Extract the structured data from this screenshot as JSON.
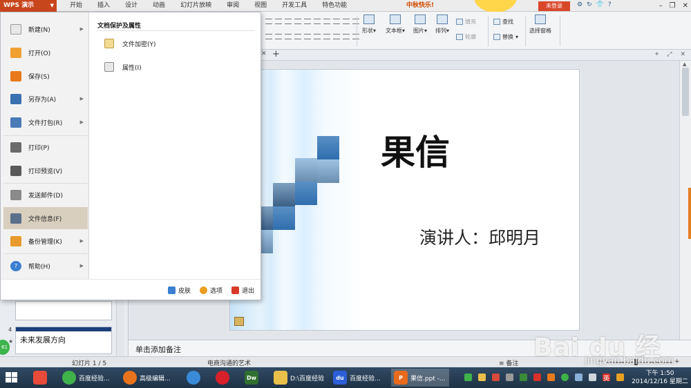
{
  "titlebar": {
    "app_name": "WPS 演示",
    "menu_tabs": [
      "开始",
      "插入",
      "设计",
      "动画",
      "幻灯片放映",
      "审阅",
      "视图",
      "开发工具",
      "特色功能"
    ],
    "festival_text": "中秋快乐!",
    "login_label": "未登录",
    "icons": [
      "settings-icon",
      "refresh-icon",
      "skin-icon",
      "help-icon"
    ],
    "window_controls": [
      "minimize-icon",
      "restore-icon",
      "close-icon"
    ]
  },
  "toolbar": {
    "shape_label": "形状",
    "textbox_label": "文本框",
    "picture_label": "图片",
    "fill_label": "填充",
    "arrange_label": "排列",
    "outline_label": "轮廓",
    "find_label": "查找",
    "replace_label": "替换",
    "select_pane_label": "选择窗格"
  },
  "file_menu": {
    "items": [
      {
        "label": "新建(N)",
        "icon": "new-document-icon",
        "color": "#e8e8e8",
        "has_arrow": true
      },
      {
        "label": "打开(O)",
        "icon": "open-folder-icon",
        "color": "#f0a030",
        "has_arrow": false
      },
      {
        "label": "保存(S)",
        "icon": "save-icon",
        "color": "#e87a1c",
        "has_arrow": false
      },
      {
        "label": "另存为(A)",
        "icon": "save-as-icon",
        "color": "#3a6fb0",
        "has_arrow": true
      },
      {
        "label": "文件打包(R)",
        "icon": "package-icon",
        "color": "#4a7ab8",
        "has_arrow": true
      },
      {
        "label": "打印(P)",
        "icon": "print-icon",
        "color": "#6a6a6a",
        "has_arrow": false
      },
      {
        "label": "打印预览(V)",
        "icon": "print-preview-icon",
        "color": "#5a5a5a",
        "has_arrow": false
      },
      {
        "label": "发送邮件(D)",
        "icon": "mail-icon",
        "color": "#8a8a8a",
        "has_arrow": false
      },
      {
        "label": "文件信息(F)",
        "icon": "file-info-icon",
        "color": "#5a6f8a",
        "has_arrow": false
      },
      {
        "label": "备份管理(K)",
        "icon": "backup-icon",
        "color": "#e89a2c",
        "has_arrow": true
      },
      {
        "label": "帮助(H)",
        "icon": "help-circle-icon",
        "color": "#3a7fd0",
        "has_arrow": true
      }
    ],
    "submenu_header": "文档保护及属性",
    "submenu_items": [
      {
        "label": "文件加密(Y)",
        "icon": "lock-icon"
      },
      {
        "label": "属性(I)",
        "icon": "properties-icon"
      }
    ],
    "footer": {
      "skin_label": "皮肤",
      "options_label": "选项",
      "exit_label": "退出"
    }
  },
  "slide": {
    "title": "果信",
    "subtitle": "演讲人：邱明月"
  },
  "slide_panel": {
    "slide4_number": "4",
    "slide4_star": "★",
    "slide4_label": "未来发展方向",
    "badge": "61"
  },
  "notes": {
    "placeholder": "单击添加备注"
  },
  "statusbar": {
    "slide_counter": "幻灯片 1 / 5",
    "theme_name": "电商沟通的艺术",
    "notes_label": "备注",
    "zoom_minus": "−",
    "zoom_plus": "+"
  },
  "taskbar": {
    "apps": [
      {
        "label": "",
        "icon": "color-pinwheel-icon",
        "color": "#e84a3a"
      },
      {
        "label": "百度经验...",
        "icon": "green-browser-icon",
        "color": "#3fb24a"
      },
      {
        "label": "高级编辑...",
        "icon": "firefox-icon",
        "color": "#e8731c"
      },
      {
        "label": "",
        "icon": "chrome-icon",
        "color": "#3a8ad8"
      },
      {
        "label": "",
        "icon": "opera-icon",
        "color": "#d8202a"
      },
      {
        "label": "",
        "icon": "dreamweaver-icon",
        "color": "#2f6f2f",
        "text": "Dw"
      },
      {
        "label": "D:\\百度经验",
        "icon": "folder-icon",
        "color": "#e8c04a"
      },
      {
        "label": "百度经验...",
        "icon": "baidu-icon",
        "color": "#2d5fd8",
        "text": "du"
      },
      {
        "label": "果信.ppt -...",
        "icon": "wps-presentation-icon",
        "color": "#e86a1c",
        "text": "P"
      }
    ],
    "ime": "英",
    "time": "下午 1:50",
    "date": "2014/12/16 星期二"
  },
  "watermark": {
    "text": "Bai du 经验",
    "url": "jingyan.baidu.com"
  }
}
